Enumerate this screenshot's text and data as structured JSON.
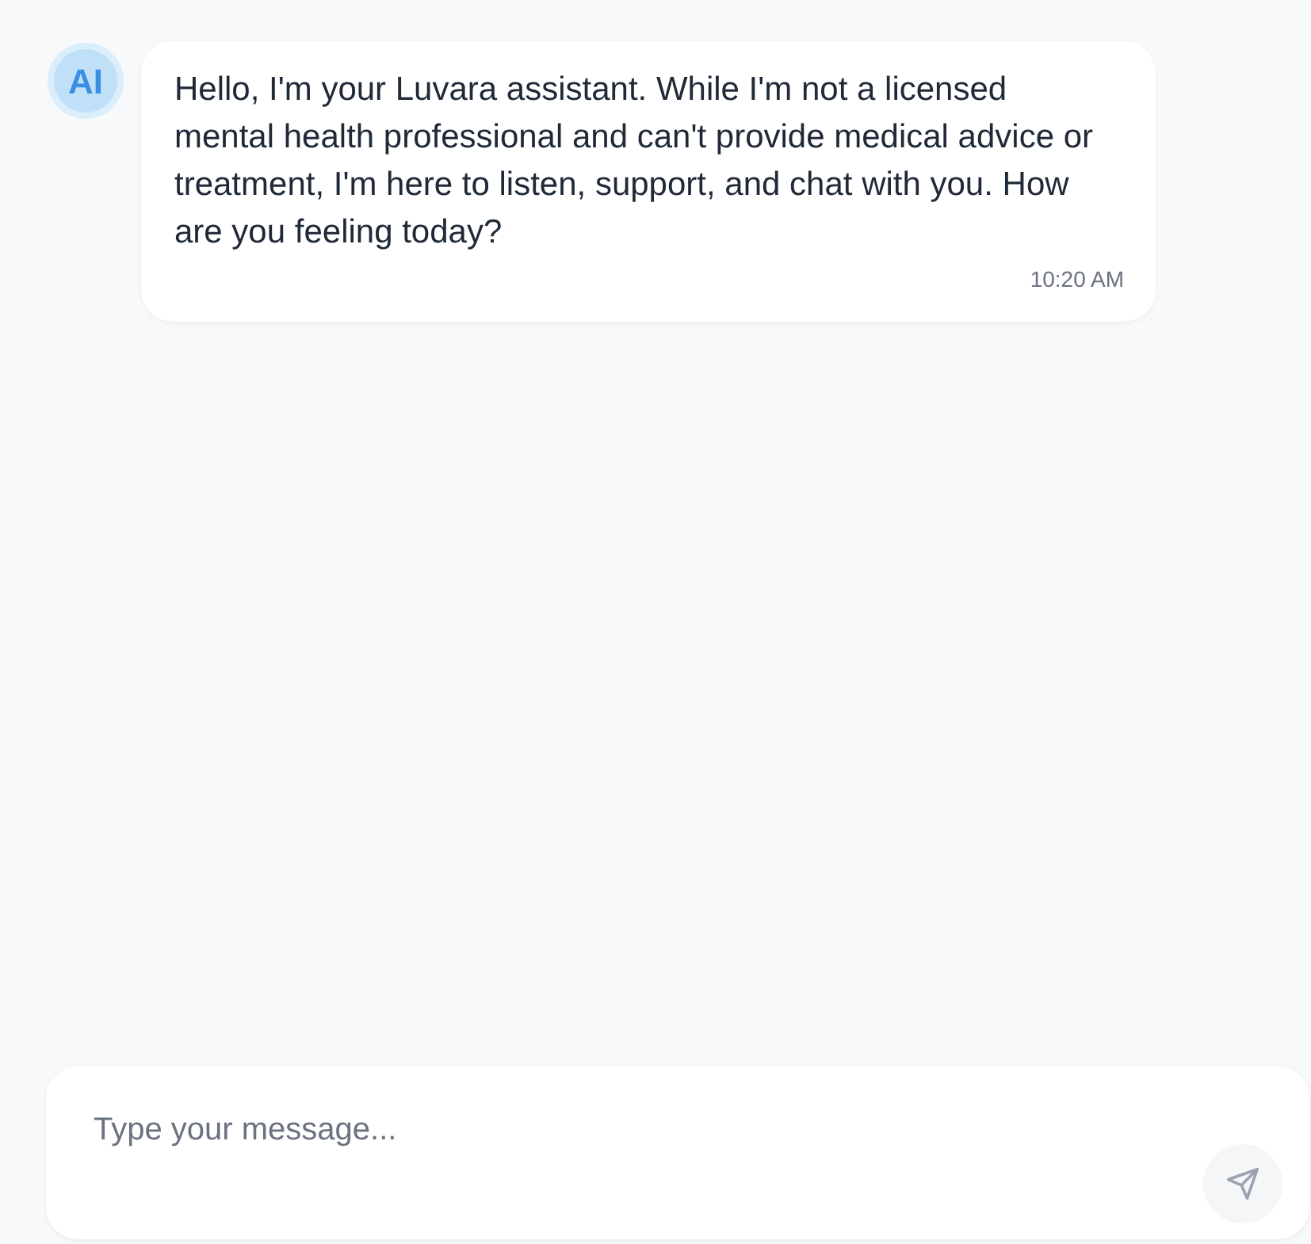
{
  "messages": [
    {
      "kind": "assistant",
      "avatar": "AI",
      "text": "Hello, I'm your Luvara assistant. While I'm not a licensed mental health professional and can't provide medical advice or treatment, I'm here to listen, support, and chat with you. How are you feeling today?",
      "time": "10:20 AM"
    }
  ],
  "composer": {
    "placeholder": "Type your message..."
  }
}
